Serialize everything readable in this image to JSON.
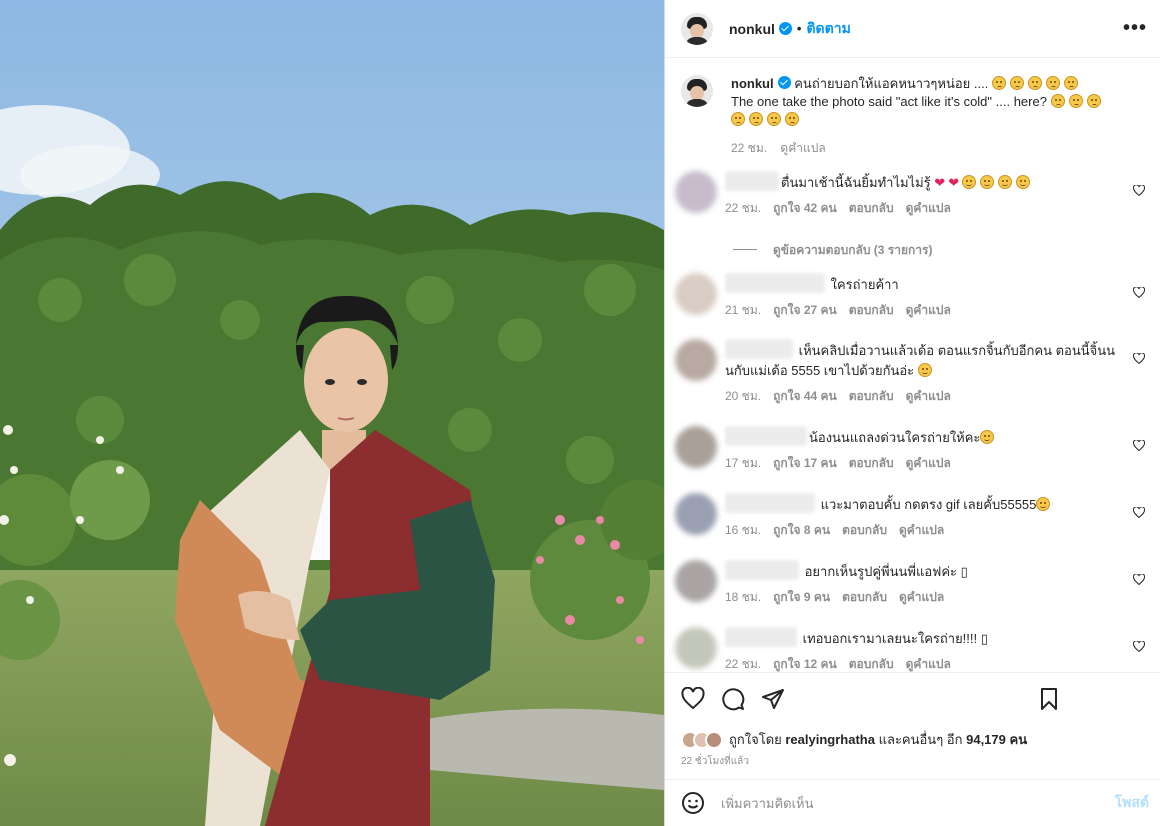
{
  "post": {
    "username": "nonkul",
    "follow_label": "ติดตาม",
    "more_label": "•••"
  },
  "caption": {
    "username": "nonkul",
    "text_th": "คนถ่ายบอกให้แอคหนาวๆหน่อย ....",
    "text_en": "The one take the photo said \"act like it's cold\" .... here?",
    "time": "22 ชม.",
    "translate": "ดูคำแปล"
  },
  "comments": [
    {
      "text": "ตื่นมาเช้านี้ฉันยิ้มทำไมไม่รู้",
      "time": "22 ชม.",
      "likes": "ถูกใจ 42 คน",
      "reply": "ตอบกลับ",
      "translate": "ดูคำแปล",
      "avatar_color": "#c8bccc",
      "name_w": 54
    },
    {
      "text": "ใครถ่ายค้าา",
      "time": "21 ชม.",
      "likes": "ถูกใจ 27 คน",
      "reply": "ตอบกลับ",
      "translate": "ดูคำแปล",
      "avatar_color": "#d9ccc4",
      "name_w": 100
    },
    {
      "text": "เห็นคลิปเมื่อวานแล้วเด้อ ตอนแรกจิ้นกับอีกคน ตอนนี้จิ้นนนกับแม่เด้อ 5555 เขาไปด้วยกันอ่ะ",
      "time": "20 ชม.",
      "likes": "ถูกใจ 44 คน",
      "reply": "ตอบกลับ",
      "translate": "ดูคำแปล",
      "avatar_color": "#b8aaa2",
      "name_w": 68
    },
    {
      "text": "น้องนนแถลงด่วนใครถ่ายให้คะ",
      "time": "17 ชม.",
      "likes": "ถูกใจ 17 คน",
      "reply": "ตอบกลับ",
      "translate": "ดูคำแปล",
      "avatar_color": "#a9a09a",
      "name_w": 82
    },
    {
      "text": "แวะมาตอบคั้บ กดตรง gif เลยคั้บ55555",
      "time": "16 ชม.",
      "likes": "ถูกใจ 8 คน",
      "reply": "ตอบกลับ",
      "translate": "ดูคำแปล",
      "avatar_color": "#9aa0b2",
      "name_w": 90
    },
    {
      "text": "อยากเห็นรูปคู่พี่นนพี่แอฟค่ะ",
      "time": "18 ชม.",
      "likes": "ถูกใจ 9 คน",
      "reply": "ตอบกลับ",
      "translate": "ดูคำแปล",
      "avatar_color": "#aaa4a4",
      "name_w": 74
    },
    {
      "text": "เทอบอกเรามาเลยนะใครถ่าย!!!!",
      "time": "22 ชม.",
      "likes": "ถูกใจ 12 คน",
      "reply": "ตอบกลับ",
      "translate": "ดูคำแปล",
      "avatar_color": "#c4c8bc",
      "name_w": 72
    }
  ],
  "view_replies": "ดูข้อความตอบกลับ (3 รายการ)",
  "likes_line": {
    "prefix": "ถูกใจโดย",
    "user": "realyingrhatha",
    "middle": "และคนอื่นๆ อีก",
    "count": "94,179",
    "suffix": "คน"
  },
  "posted_ago": "22 ชั่วโมงที่แล้ว",
  "add_comment": {
    "placeholder": "เพิ่มความคิดเห็น",
    "post_label": "โพสต์"
  }
}
